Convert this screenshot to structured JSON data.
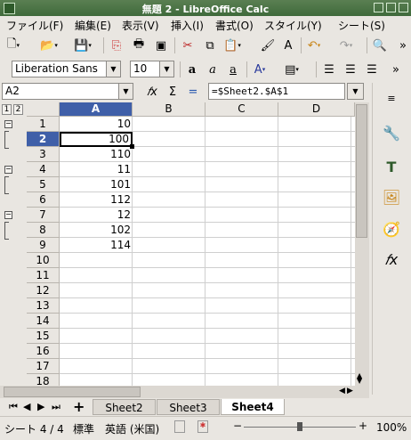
{
  "window": {
    "title": "無題 2 - LibreOffice Calc"
  },
  "menu": [
    "ファイル(F)",
    "編集(E)",
    "表示(V)",
    "挿入(I)",
    "書式(O)",
    "スタイル(Y)",
    "シート(S)"
  ],
  "font": {
    "name": "Liberation Sans",
    "size": "10"
  },
  "formula": {
    "cell_ref": "A2",
    "content": "=$Sheet2.$A$1"
  },
  "outline_levels": [
    "1",
    "2"
  ],
  "columns": [
    "A",
    "B",
    "C",
    "D"
  ],
  "rows": [
    "1",
    "2",
    "3",
    "4",
    "5",
    "6",
    "7",
    "8",
    "9",
    "10",
    "11",
    "12",
    "13",
    "14",
    "15",
    "16",
    "17",
    "18"
  ],
  "cellsA": [
    "10",
    "100",
    "110",
    "11",
    "101",
    "112",
    "12",
    "102",
    "114"
  ],
  "tabs": [
    "Sheet2",
    "Sheet3",
    "Sheet4"
  ],
  "tab_add": "+",
  "status": {
    "sheet": "シート 4 / 4",
    "style": "標準",
    "language": "英語 (米国)",
    "zoom": "100%"
  }
}
